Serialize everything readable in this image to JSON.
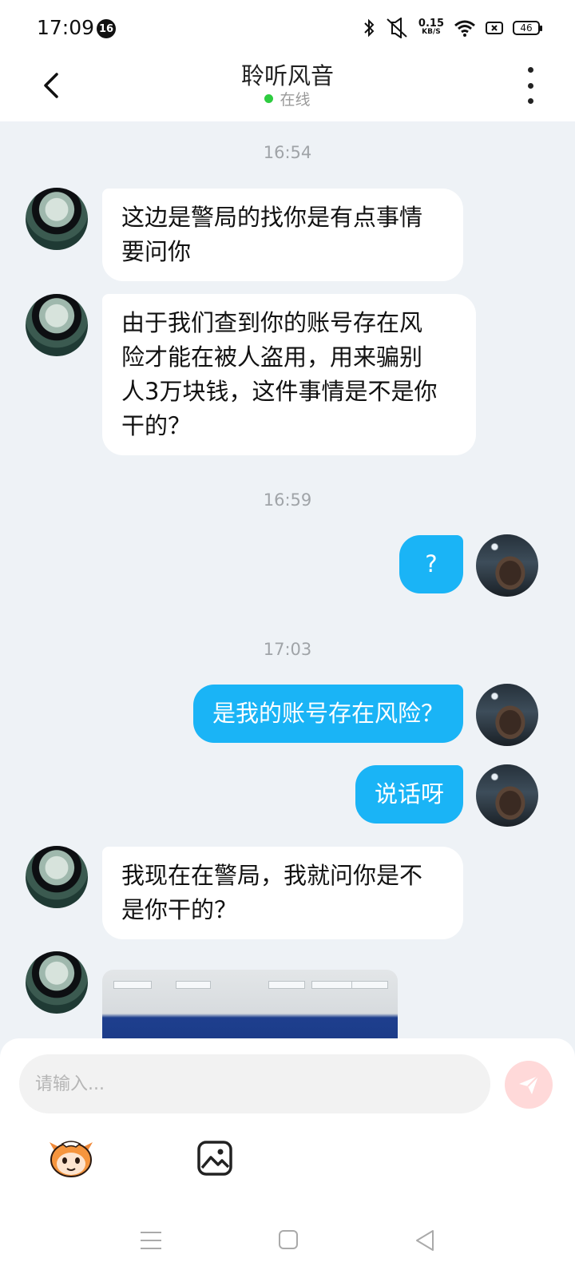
{
  "status_bar": {
    "time": "17:09",
    "notification_count": "16",
    "net_speed_value": "0.15",
    "net_speed_unit": "KB/S",
    "battery": "46",
    "icons": [
      "bluetooth-icon",
      "mute-icon",
      "wifi-icon",
      "sim-icon",
      "battery-icon"
    ]
  },
  "header": {
    "title": "聆听风音",
    "status": "在线",
    "status_color": "#2ecc40"
  },
  "messages": [
    {
      "type": "timestamp",
      "text": "16:54"
    },
    {
      "type": "incoming",
      "text_lines": [
        "这边是警局的找你是有点事情",
        "要问你"
      ]
    },
    {
      "type": "incoming",
      "text_lines": [
        "由于我们查到你的账号存在风",
        "险才能在被人盗用，用来骗别",
        "人3万块钱，这件事情是不是你",
        "干的？"
      ]
    },
    {
      "type": "timestamp",
      "text": "16:59"
    },
    {
      "type": "outgoing",
      "text": "?"
    },
    {
      "type": "timestamp",
      "text": "17:03"
    },
    {
      "type": "outgoing",
      "text": "是我的账号存在风险？"
    },
    {
      "type": "outgoing",
      "text": "说话呀"
    },
    {
      "type": "incoming",
      "text_lines": [
        "我现在在警局，我就问你是不",
        "是你干的？"
      ]
    },
    {
      "type": "incoming-image"
    }
  ],
  "input": {
    "placeholder": "请输入..."
  },
  "colors": {
    "outgoing_bubble": "#1ab4f6",
    "incoming_bubble": "#ffffff",
    "background": "#eef2f6",
    "send_button": "#ffd9d9"
  },
  "toolbar_icons": [
    "emoji-icon",
    "image-icon"
  ],
  "nav_icons": [
    "menu-icon",
    "home-icon",
    "back-icon"
  ]
}
